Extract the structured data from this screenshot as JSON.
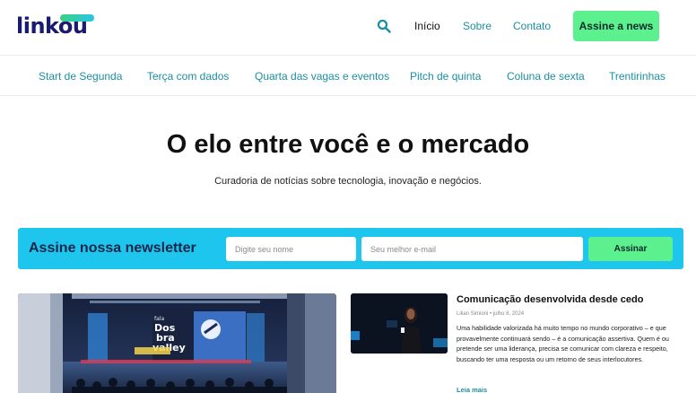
{
  "header": {
    "logo_text": "linkou",
    "nav": {
      "inicio": "Início",
      "sobre": "Sobre",
      "contato": "Contato"
    },
    "cta_label": "Assine a news",
    "icons": {
      "search": "search-icon"
    }
  },
  "categories": [
    "Start de Segunda",
    "Terça com dados",
    "Quarta das vagas e eventos",
    "Pitch de quinta",
    "Coluna de sexta",
    "Trentirinhas"
  ],
  "hero": {
    "title": "O elo entre você e o mercado",
    "subtitle": "Curadoria de notícias sobre tecnologia, inovação e negócios."
  },
  "newsletter": {
    "title": "Assine nossa newsletter",
    "name_placeholder": "Digite seu nome",
    "email_placeholder": "Seu melhor e-mail",
    "name_value": "",
    "email_value": "",
    "button_label": "Assinar"
  },
  "featured": {
    "image_text": [
      "Dos",
      "bra",
      "valley"
    ]
  },
  "article": {
    "title": "Comunicação desenvolvida desde cedo",
    "meta": "Lilian Simioni • julho 8, 2024",
    "excerpt": "Uma habilidade valorizada há muito tempo no mundo corporativo – e que provavelmente continuará sendo – é a comunicação assertiva. Quem é ou pretende ser uma liderança, precisa se comunicar com clareza e respeito, buscando ter uma resposta ou um retorno de seus interlocutores.",
    "read_more": "Leia mais"
  },
  "colors": {
    "brand_navy": "#1a1a6e",
    "accent_teal": "#1a8fa0",
    "cta_green": "#5df08e",
    "newsletter_blue": "#1ec6ee"
  }
}
